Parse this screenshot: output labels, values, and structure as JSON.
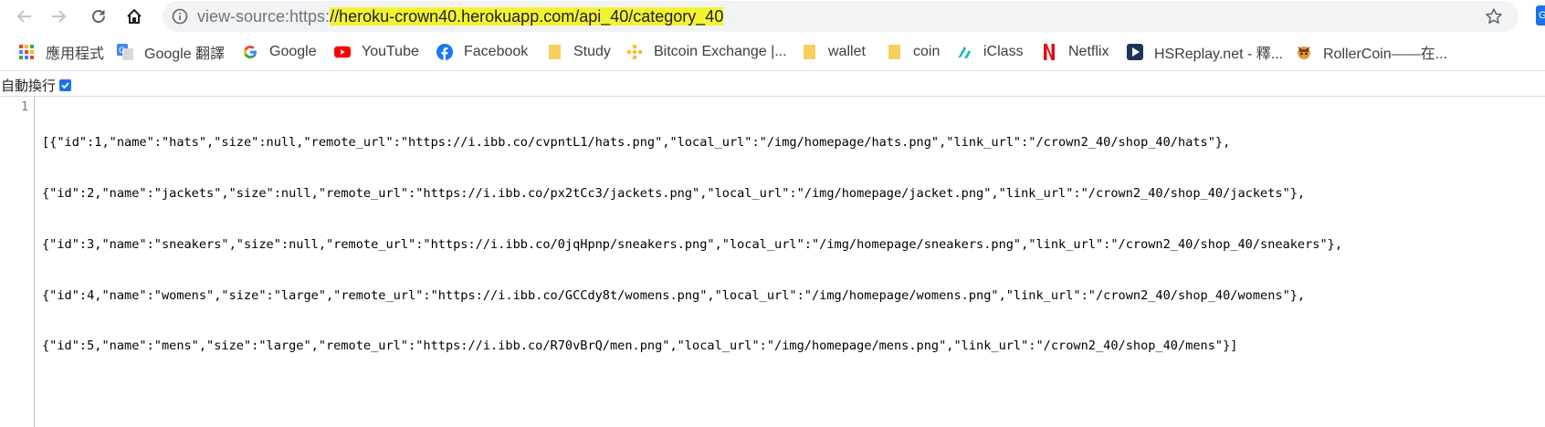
{
  "browser": {
    "url_prefix": "view-source:https:",
    "url_highlight": "//heroku-crown40.herokuapp.com/api_40/category_40",
    "edge_badge": "G"
  },
  "bookmarks": [
    {
      "label": "應用程式",
      "icon": "apps-grid-icon"
    },
    {
      "label": "Google 翻譯",
      "icon": "google-translate-icon"
    },
    {
      "label": "Google",
      "icon": "google-icon"
    },
    {
      "label": "YouTube",
      "icon": "youtube-icon"
    },
    {
      "label": "Facebook",
      "icon": "facebook-icon"
    },
    {
      "label": "Study",
      "icon": "folder-icon"
    },
    {
      "label": "Bitcoin Exchange |...",
      "icon": "binance-icon"
    },
    {
      "label": "wallet",
      "icon": "folder-icon"
    },
    {
      "label": "coin",
      "icon": "folder-icon"
    },
    {
      "label": "iClass",
      "icon": "iclass-icon"
    },
    {
      "label": "Netflix",
      "icon": "netflix-icon"
    },
    {
      "label": "HSReplay.net - 釋...",
      "icon": "hsreplay-icon"
    },
    {
      "label": "RollerCoin——在...",
      "icon": "rollercoin-icon"
    }
  ],
  "line_wrap": {
    "label": "自動換行",
    "checked": true
  },
  "source": {
    "line_number": "1",
    "lines": [
      "[{\"id\":1,\"name\":\"hats\",\"size\":null,\"remote_url\":\"https://i.ibb.co/cvpntL1/hats.png\",\"local_url\":\"/img/homepage/hats.png\",\"link_url\":\"/crown2_40/shop_40/hats\"},",
      "{\"id\":2,\"name\":\"jackets\",\"size\":null,\"remote_url\":\"https://i.ibb.co/px2tCc3/jackets.png\",\"local_url\":\"/img/homepage/jacket.png\",\"link_url\":\"/crown2_40/shop_40/jackets\"},",
      "{\"id\":3,\"name\":\"sneakers\",\"size\":null,\"remote_url\":\"https://i.ibb.co/0jqHpnp/sneakers.png\",\"local_url\":\"/img/homepage/sneakers.png\",\"link_url\":\"/crown2_40/shop_40/sneakers\"},",
      "{\"id\":4,\"name\":\"womens\",\"size\":\"large\",\"remote_url\":\"https://i.ibb.co/GCCdy8t/womens.png\",\"local_url\":\"/img/homepage/womens.png\",\"link_url\":\"/crown2_40/shop_40/womens\"},",
      "{\"id\":5,\"name\":\"mens\",\"size\":\"large\",\"remote_url\":\"https://i.ibb.co/R70vBrQ/men.png\",\"local_url\":\"/img/homepage/mens.png\",\"link_url\":\"/crown2_40/shop_40/mens\"}]"
    ]
  }
}
